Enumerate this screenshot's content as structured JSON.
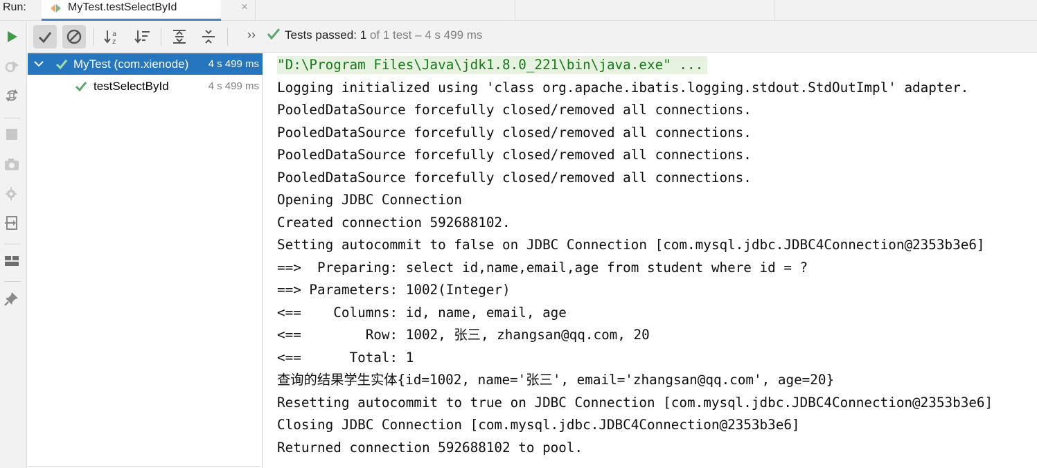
{
  "run_label": "Run:",
  "tab": {
    "title": "MyTest.testSelectById",
    "close": "×"
  },
  "toolbar": {
    "more": "››",
    "status_strong": "Tests passed:",
    "status_count": "1",
    "status_rest": "of 1 test – 4 s 499 ms"
  },
  "tree": {
    "suite": {
      "name": "MyTest (com.xienode)",
      "time": "4 s 499 ms"
    },
    "tests": [
      {
        "name": "testSelectById",
        "time": "4 s 499 ms"
      }
    ]
  },
  "console": {
    "lines": [
      "\"D:\\Program Files\\Java\\jdk1.8.0_221\\bin\\java.exe\" ...",
      "Logging initialized using 'class org.apache.ibatis.logging.stdout.StdOutImpl' adapter.",
      "PooledDataSource forcefully closed/removed all connections.",
      "PooledDataSource forcefully closed/removed all connections.",
      "PooledDataSource forcefully closed/removed all connections.",
      "PooledDataSource forcefully closed/removed all connections.",
      "Opening JDBC Connection",
      "Created connection 592688102.",
      "Setting autocommit to false on JDBC Connection [com.mysql.jdbc.JDBC4Connection@2353b3e6]",
      "==>  Preparing: select id,name,email,age from student where id = ?",
      "==> Parameters: 1002(Integer)",
      "<==    Columns: id, name, email, age",
      "<==        Row: 1002, 张三, zhangsan@qq.com, 20",
      "<==      Total: 1",
      "查询的结果学生实体{id=1002, name='张三', email='zhangsan@qq.com', age=20}",
      "Resetting autocommit to true on JDBC Connection [com.mysql.jdbc.JDBC4Connection@2353b3e6]",
      "Closing JDBC Connection [com.mysql.jdbc.JDBC4Connection@2353b3e6]",
      "Returned connection 592688102 to pool."
    ]
  },
  "colors": {
    "accent": "#2675bf",
    "pass_green": "#59a869",
    "run_green": "#3f9b48",
    "cmd_text": "#157a17",
    "cmd_bg": "#e8f2e1"
  }
}
